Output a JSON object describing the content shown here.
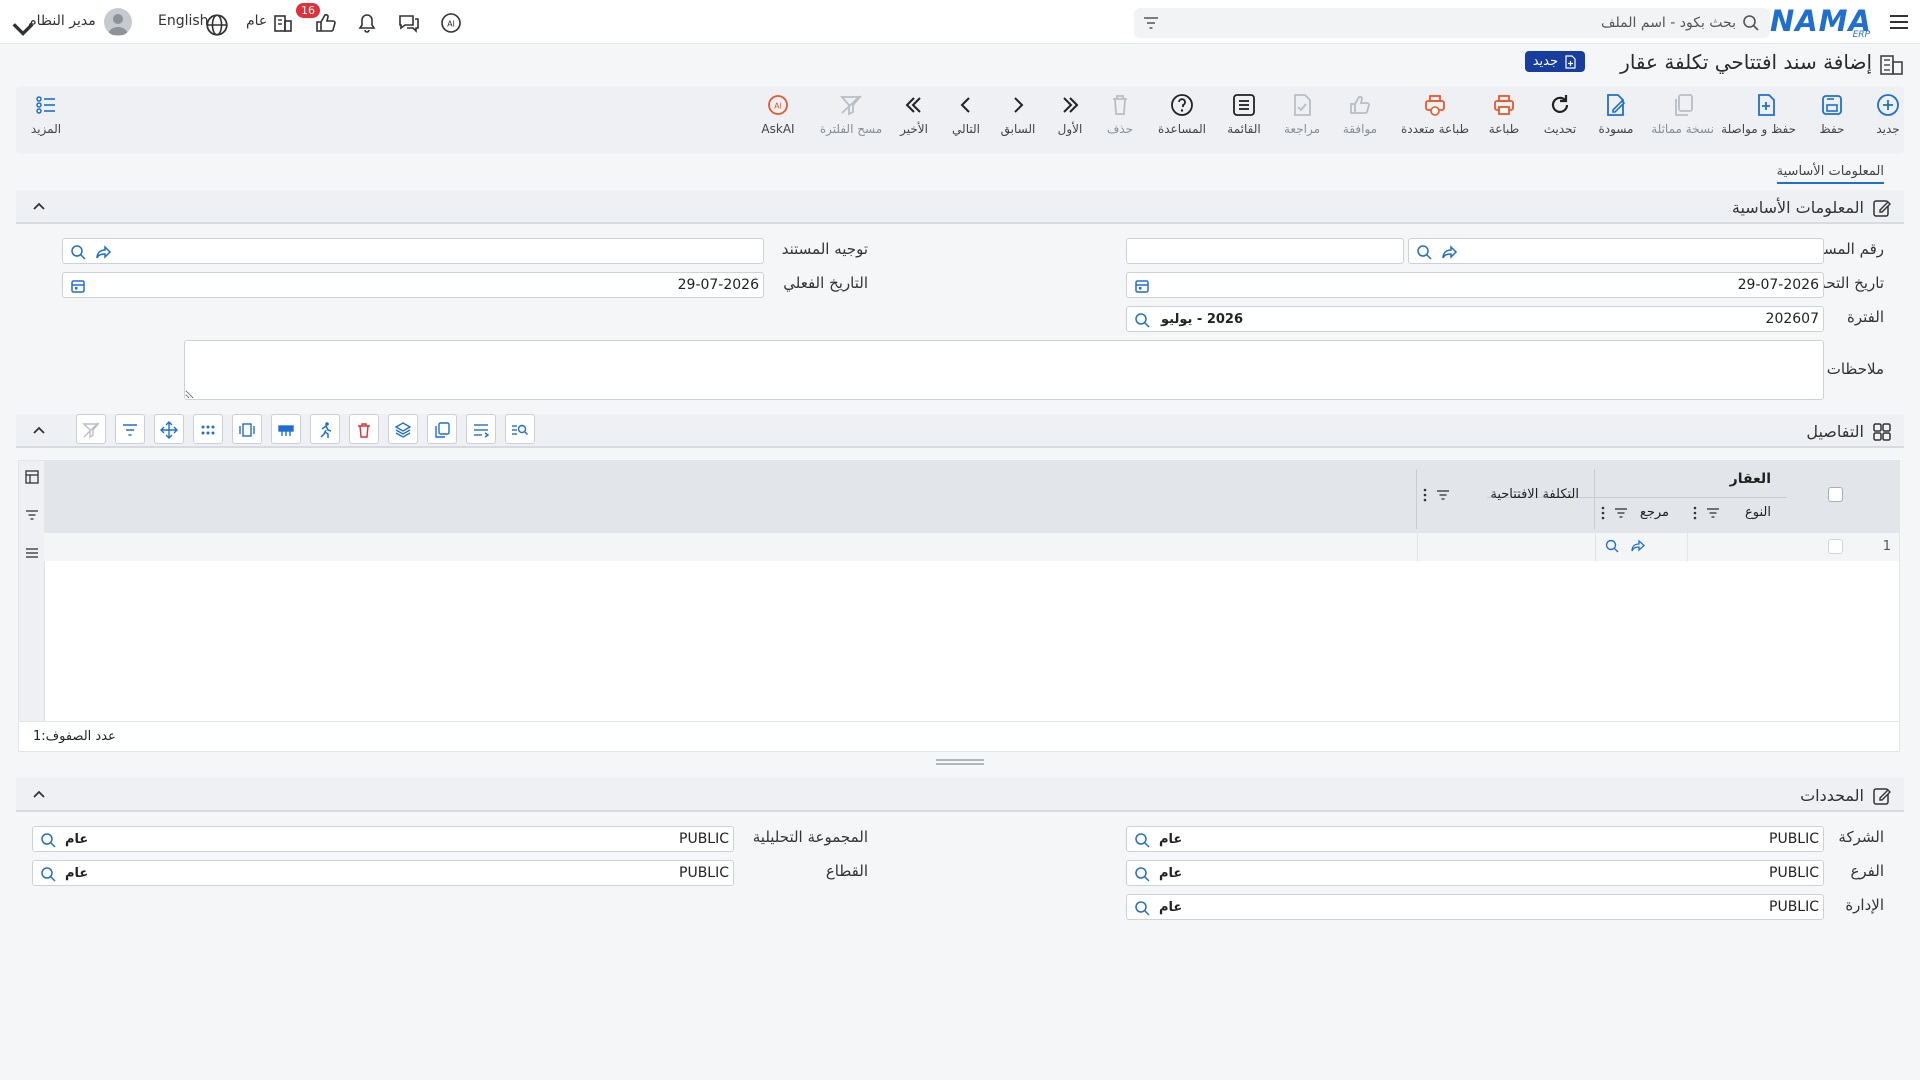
{
  "topbar": {
    "logo_text": "NAMA",
    "logo_sub": "ERP",
    "search_placeholder": "بحث بكود - اسم الملف",
    "notifications_count": "16",
    "lang_label": "English",
    "scope_label": "عام",
    "user_name": "مدير النظام"
  },
  "page": {
    "title": "إضافة سند افتتاحي تكلفة عقار",
    "new_label": "جديد"
  },
  "toolbar": {
    "new": "جديد",
    "save": "حفظ",
    "save_continue": "حفظ و مواصلة",
    "duplicate": "نسخة مماثلة",
    "draft": "مسودة",
    "refresh": "تحديث",
    "print": "طباعة",
    "multi_print": "طباعة متعددة",
    "approve": "موافقة",
    "review": "مراجعة",
    "list": "القائمة",
    "help": "المساعدة",
    "delete": "حذف",
    "first": "الأول",
    "prev": "السابق",
    "next": "التالي",
    "last": "الأخير",
    "clear_filter": "مسح الفلترة",
    "askai": "AskAI",
    "more": "المزيد"
  },
  "tabs": {
    "basic": "المعلومات الأساسية"
  },
  "basic": {
    "section_title": "المعلومات الأساسية",
    "doc_number_label": "رقم المستند",
    "doc_number_value": "",
    "doc_direction_label": "توجيه المستند",
    "doc_direction_value": "",
    "edit_date_label": "تاريخ التحرير",
    "edit_date_value": "29-07-2026",
    "actual_date_label": "التاريخ الفعلي",
    "actual_date_value": "29-07-2026",
    "period_label": "الفترة",
    "period_value": "202607",
    "period_name": "2026 - يوليو",
    "notes_label": "ملاحظات"
  },
  "details": {
    "section_title": "التفاصيل",
    "group_header": "العقار",
    "col_type": "النوع",
    "col_ref": "مرجع",
    "col_cost": "التكلفة الافتتاحية",
    "row_number": "1",
    "row_count_text": "عدد الصفوف:1"
  },
  "dimensions": {
    "section_title": "المحددات",
    "company_label": "الشركة",
    "branch_label": "الفرع",
    "department_label": "الإدارة",
    "analytic_label": "المجموعة التحليلية",
    "sector_label": "القطاع",
    "code_value": "PUBLIC",
    "name_value": "عام"
  },
  "colors": {
    "brand": "#1f6fd1",
    "new_badge": "#173e9c",
    "print_orange": "#e8582c",
    "notify_red": "#e0303a"
  }
}
